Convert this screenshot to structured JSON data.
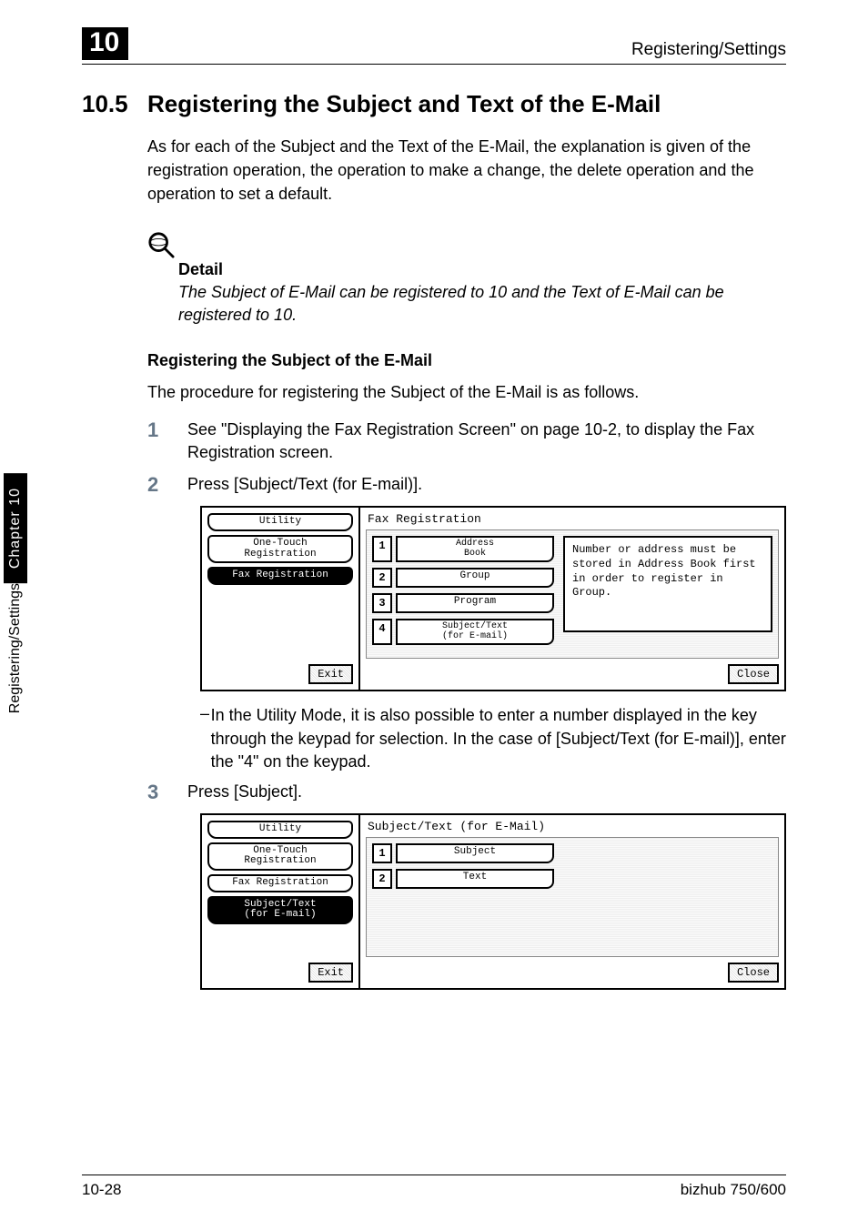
{
  "header": {
    "chapter_number": "10",
    "running_title": "Registering/Settings"
  },
  "side_tab": {
    "chapter": "Chapter 10",
    "title": "Registering/Settings"
  },
  "section": {
    "number": "10.5",
    "title": "Registering the Subject and Text of the E-Mail",
    "intro": "As for each of the Subject and the Text of the E-Mail, the explanation is given of the registration operation, the operation to make a change, the delete operation and the operation to set a default."
  },
  "detail": {
    "heading": "Detail",
    "text": "The Subject of E-Mail can be registered to 10 and the Text of E-Mail can be registered to 10."
  },
  "subsection": {
    "heading": "Registering the Subject of the E-Mail",
    "intro": "The procedure for registering the Subject of the E-Mail is as follows."
  },
  "steps": [
    {
      "num": "1",
      "text": "See \"Displaying the Fax Registration Screen\" on page 10-2, to display the Fax Registration screen."
    },
    {
      "num": "2",
      "text": "Press [Subject/Text (for E-mail)]."
    },
    {
      "num": "3",
      "text": "Press [Subject]."
    }
  ],
  "substep": {
    "text": "In the Utility Mode, it is also possible to enter a number displayed in the key through the keypad for selection. In the case of [Subject/Text (for E-mail)], enter the \"4\" on the keypad."
  },
  "screen1": {
    "left_tabs": {
      "utility": "Utility",
      "one_touch": "One-Touch\nRegistration",
      "fax_reg": "Fax Registration"
    },
    "exit": "Exit",
    "title": "Fax Registration",
    "buttons": [
      {
        "n": "1",
        "label": "Address\nBook"
      },
      {
        "n": "2",
        "label": "Group"
      },
      {
        "n": "3",
        "label": "Program"
      },
      {
        "n": "4",
        "label": "Subject/Text\n(for E-mail)"
      }
    ],
    "message": "Number or address must be stored in Address Book first in order to register in Group.",
    "close": "Close"
  },
  "screen2": {
    "left_tabs": {
      "utility": "Utility",
      "one_touch": "One-Touch\nRegistration",
      "fax_reg": "Fax Registration",
      "subject_text": "Subject/Text\n(for E-mail)"
    },
    "exit": "Exit",
    "title": "Subject/Text (for E-Mail)",
    "buttons": [
      {
        "n": "1",
        "label": "Subject"
      },
      {
        "n": "2",
        "label": "Text"
      }
    ],
    "close": "Close"
  },
  "footer": {
    "page": "10-28",
    "model": "bizhub 750/600"
  }
}
